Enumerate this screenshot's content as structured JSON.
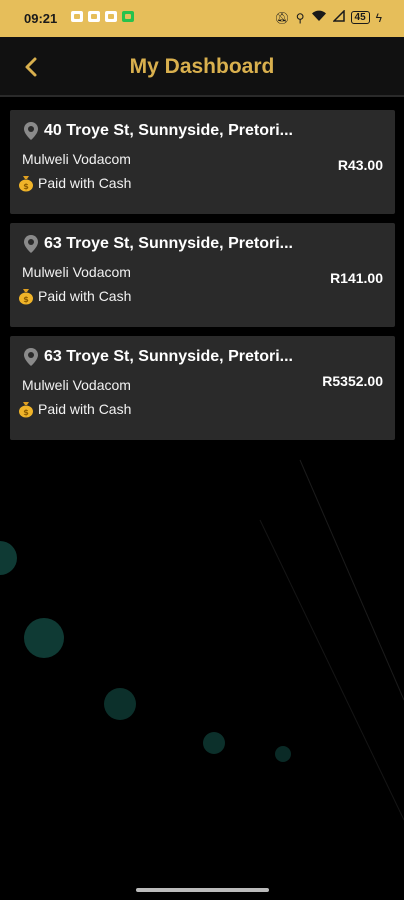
{
  "status_bar": {
    "time": "09:21",
    "battery": "45",
    "icons": [
      "youtube-icon",
      "a-icon",
      "o-icon",
      "whatsapp-icon",
      "mute-icon",
      "location-icon",
      "wifi-icon",
      "signal-icon",
      "charging-icon"
    ]
  },
  "header": {
    "title": "My Dashboard",
    "back_icon": "chevron-left-icon"
  },
  "colors": {
    "accent": "#d9b04e",
    "status_bar": "#e6be5a",
    "card": "#2a2a2a",
    "background": "#000000"
  },
  "transactions": [
    {
      "address": "40 Troye St, Sunnyside, Pretori...",
      "vendor": "Mulweli Vodacom",
      "payment": "Paid with Cash",
      "amount": "R43.00"
    },
    {
      "address": "63 Troye St, Sunnyside, Pretori...",
      "vendor": "Mulweli Vodacom",
      "payment": "Paid with Cash",
      "amount": "R141.00"
    },
    {
      "address": "63 Troye St, Sunnyside, Pretori...",
      "vendor": "Mulweli Vodacom",
      "payment": "Paid with Cash",
      "amount": "R5352.00"
    }
  ]
}
